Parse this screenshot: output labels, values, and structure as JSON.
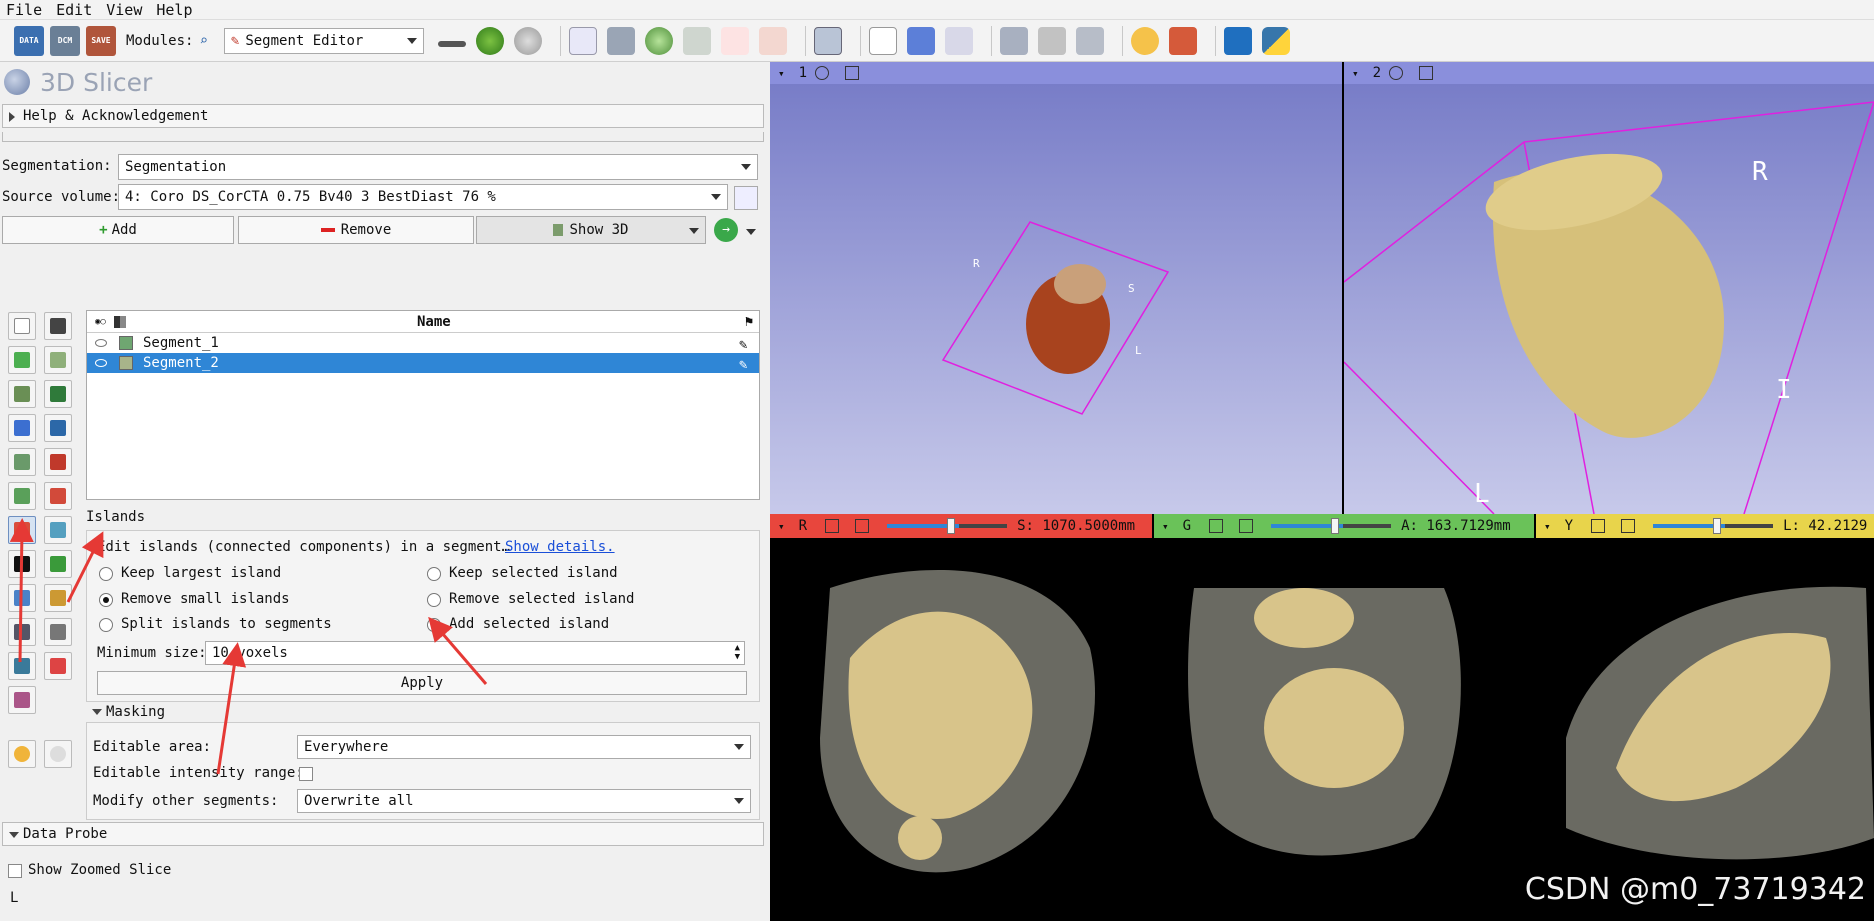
{
  "menu": [
    "File",
    "Edit",
    "View",
    "Help"
  ],
  "toolbar": {
    "modules_label": "Modules:",
    "module_name": "Segment Editor",
    "data_label": "DATA",
    "dcm_label": "DCM",
    "save_label": "SAVE"
  },
  "app_title": "3D Slicer",
  "help_section": "Help & Acknowledgement",
  "segmentation": {
    "label": "Segmentation:",
    "value": "Segmentation"
  },
  "source_volume": {
    "label": "Source volume:",
    "value": "4: Coro  DS_CorCTA  0.75  Bv40  3  BestDiast 76 %"
  },
  "buttons": {
    "add": "Add",
    "remove": "Remove",
    "show3d": "Show 3D"
  },
  "table": {
    "header_name": "Name",
    "rows": [
      {
        "name": "Segment_1",
        "color": "#6fa671",
        "selected": false
      },
      {
        "name": "Segment_2",
        "color": "#a8b48a",
        "selected": true
      }
    ]
  },
  "islands": {
    "title": "Islands",
    "description": "Edit islands (connected components) in a segment…",
    "show_details": "Show details.",
    "options": {
      "keep_largest": "Keep largest island",
      "remove_small": "Remove small islands",
      "split": "Split islands to segments",
      "keep_selected": "Keep selected island",
      "remove_selected": "Remove selected island",
      "add_selected": "Add selected island"
    },
    "selected_option": "remove_small",
    "min_size_label": "Minimum size:",
    "min_size_value": "10 voxels",
    "apply": "Apply"
  },
  "masking": {
    "title": "Masking",
    "editable_area_label": "Editable area:",
    "editable_area_value": "Everywhere",
    "intensity_label": "Editable intensity range:",
    "modify_label": "Modify other segments:",
    "modify_value": "Overwrite all"
  },
  "data_probe": {
    "title": "Data Probe",
    "show_zoomed": "Show Zoomed Slice",
    "l_label": "L"
  },
  "views": {
    "view1_id": "1",
    "view2_id": "2",
    "red_label": "R",
    "red_value": "S: 1070.5000mm",
    "green_label": "G",
    "green_value": "A: 163.7129mm",
    "yellow_label": "Y",
    "yellow_value": "L: 42.2129",
    "orient_r": "R",
    "orient_i": "I",
    "orient_l": "L",
    "orient_s": "S"
  },
  "watermark": "CSDN @m0_73719342",
  "colors": {
    "accent": "#2f86d6",
    "red_bar": "#e8463d",
    "green_bar": "#6ac259",
    "yellow_bar": "#e8d44b",
    "segment": "#d9c48a",
    "annotation": "#e53935"
  }
}
